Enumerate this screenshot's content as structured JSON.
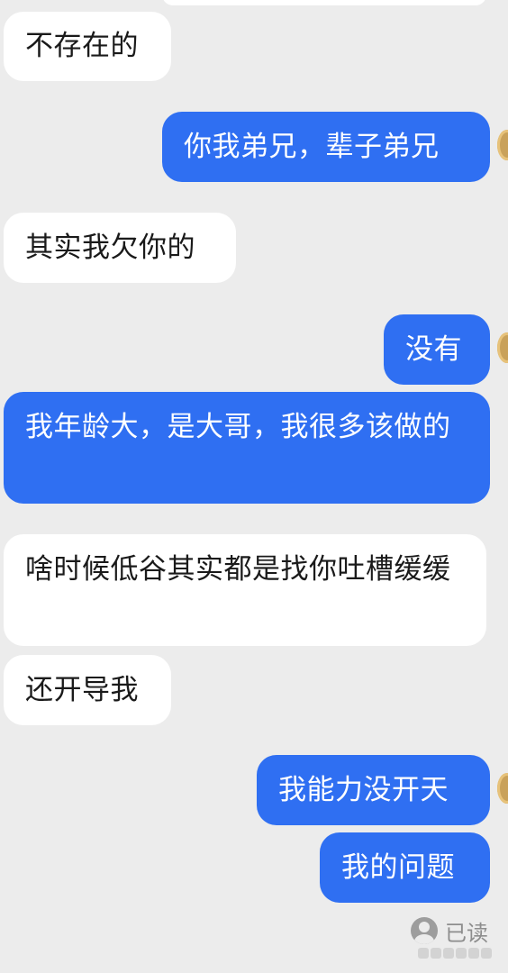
{
  "messages": [
    {
      "side": "in",
      "text": "不存在的"
    },
    {
      "side": "out",
      "text": "你我弟兄，辈子弟兄"
    },
    {
      "side": "in",
      "text": "其实我欠你的"
    },
    {
      "side": "out",
      "text": "没有"
    },
    {
      "side": "out",
      "text": "我年龄大，是大哥，我很多该做的"
    },
    {
      "side": "in",
      "text": "啥时候低谷其实都是找你吐槽缓缓"
    },
    {
      "side": "in",
      "text": "还开导我"
    },
    {
      "side": "out",
      "text": "我能力没开天"
    },
    {
      "side": "out",
      "text": "我的问题"
    }
  ],
  "status": {
    "read_label": "已读"
  },
  "colors": {
    "background": "#ececec",
    "incoming_bubble": "#ffffff",
    "outgoing_bubble": "#2f6ff2",
    "incoming_text": "#1a1a1a",
    "outgoing_text": "#ffffff",
    "read_text": "#8d8d8d"
  },
  "icons": {
    "read_status": "read-person-icon",
    "avatar": "avatar-icon"
  }
}
